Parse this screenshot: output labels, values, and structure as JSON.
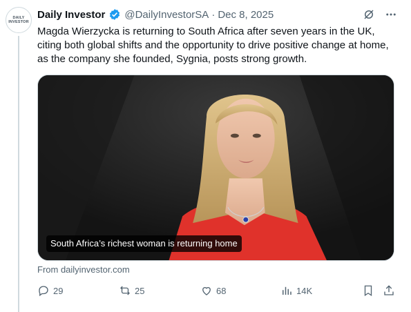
{
  "avatar": {
    "line1": "DAILY",
    "line2": "INVESTOR"
  },
  "post": {
    "author_name": "Daily Investor",
    "author_handle": "@DailyInvestorSA",
    "separator": "·",
    "date": "Dec 8, 2025",
    "text": "Magda Wierzycka is returning to South Africa after seven years in the UK, citing both global shifts and the opportunity to drive positive change at home, as the company she founded, Sygnia, posts strong growth."
  },
  "card": {
    "caption": "South Africa’s richest woman is returning home",
    "source": "From dailyinvestor.com"
  },
  "actions": {
    "replies": "29",
    "reposts": "25",
    "likes": "68",
    "views": "14K"
  },
  "colors": {
    "accent": "#1d9bf0",
    "text_primary": "#0f1419",
    "text_secondary": "#536471",
    "border": "#cfd9de",
    "dress": "#e0322b"
  }
}
